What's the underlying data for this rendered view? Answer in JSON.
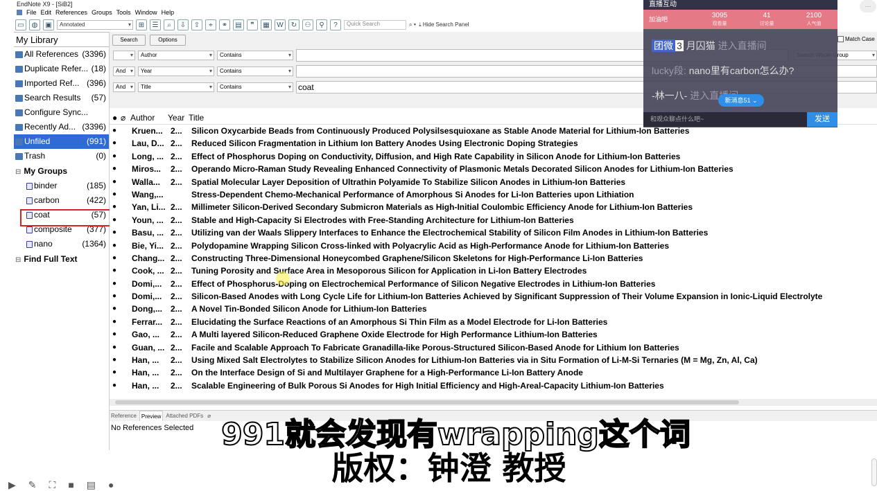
{
  "window": {
    "title": "EndNote X9 - [SiB2]"
  },
  "menu": [
    "File",
    "Edit",
    "References",
    "Groups",
    "Tools",
    "Window",
    "Help"
  ],
  "toolbar": {
    "style": "Annotated",
    "quick_search_placeholder": "Quick Search",
    "hide_search_panel": "Hide Search Panel"
  },
  "sidebar": {
    "library_title": "My Library",
    "items": [
      {
        "label": "All References",
        "count": "(3396)"
      },
      {
        "label": "Duplicate Refer...",
        "count": "(18)"
      },
      {
        "label": "Imported Ref...",
        "count": "(396)"
      },
      {
        "label": "Search Results",
        "count": "(57)"
      },
      {
        "label": "Configure Sync...",
        "count": ""
      },
      {
        "label": "Recently Ad...",
        "count": "(3396)"
      },
      {
        "label": "Unfiled",
        "count": "(991)"
      },
      {
        "label": "Trash",
        "count": "(0)"
      }
    ],
    "groups_heading": "My Groups",
    "groups": [
      {
        "label": "binder",
        "count": "(185)"
      },
      {
        "label": "carbon",
        "count": "(422)"
      },
      {
        "label": "coat",
        "count": "(57)"
      },
      {
        "label": "composite",
        "count": "(377)"
      },
      {
        "label": "nano",
        "count": "(1364)"
      }
    ],
    "find_full_text": "Find Full Text"
  },
  "search_panel": {
    "search_button": "Search",
    "options_button": "Options",
    "scope": "Search Whole Group",
    "match_case": "Match Case",
    "rows": [
      {
        "bool": "",
        "field": "Author",
        "condition": "Contains",
        "value": ""
      },
      {
        "bool": "And",
        "field": "Year",
        "condition": "Contains",
        "value": ""
      },
      {
        "bool": "And",
        "field": "Title",
        "condition": "Contains",
        "value": "coat"
      }
    ]
  },
  "list": {
    "headers": {
      "author": "Author",
      "year": "Year",
      "title": "Title"
    },
    "rows": [
      {
        "author": "Kruen...",
        "year": "2...",
        "title": "Silicon Oxycarbide Beads from Continuously Produced Polysilsesquioxane as Stable Anode Material for Lithium-Ion Batteries"
      },
      {
        "author": "Lau, D...",
        "year": "2...",
        "title": "Reduced Silicon Fragmentation in Lithium Ion Battery Anodes Using Electronic Doping Strategies"
      },
      {
        "author": "Long, ...",
        "year": "2...",
        "title": "Effect of Phosphorus Doping on Conductivity, Diffusion, and High Rate Capability in Silicon Anode for Lithium-Ion Batteries"
      },
      {
        "author": "Miros...",
        "year": "2...",
        "title": "Operando Micro-Raman Study Revealing Enhanced Connectivity of Plasmonic Metals Decorated Silicon Anodes for Lithium-Ion Batteries"
      },
      {
        "author": "Walla...",
        "year": "2...",
        "title": "Spatial Molecular Layer Deposition of Ultrathin Polyamide To Stabilize Silicon Anodes in Lithium-Ion Batteries"
      },
      {
        "author": "Wang,...",
        "year": "",
        "title": "Stress-Dependent Chemo-Mechanical Performance of Amorphous Si Anodes for Li-Ion Batteries upon Lithiation"
      },
      {
        "author": "Yan, Li...",
        "year": "2...",
        "title": "Millimeter Silicon-Derived Secondary Submicron Materials as High-Initial Coulombic Efficiency Anode for Lithium-Ion Batteries"
      },
      {
        "author": "Youn, ...",
        "year": "2...",
        "title": "Stable and High-Capacity Si Electrodes with Free-Standing Architecture for Lithium-Ion Batteries"
      },
      {
        "author": "Basu, ...",
        "year": "2...",
        "title": "Utilizing van der Waals Slippery Interfaces to Enhance the Electrochemical Stability of Silicon Film Anodes in Lithium-Ion Batteries"
      },
      {
        "author": "Bie, Yi...",
        "year": "2...",
        "title": "Polydopamine Wrapping Silicon Cross-linked with Polyacrylic Acid as High-Performance Anode for Lithium-Ion Batteries"
      },
      {
        "author": "Chang...",
        "year": "2...",
        "title": "Constructing Three-Dimensional Honeycombed Graphene/Silicon Skeletons for High-Performance Li-Ion Batteries"
      },
      {
        "author": "Cook, ...",
        "year": "2...",
        "title": "Tuning Porosity and Surface Area in Mesoporous Silicon for Application in Li-Ion Battery Electrodes"
      },
      {
        "author": "Domi,...",
        "year": "2...",
        "title": "Effect of Phosphorus-Doping on Electrochemical Performance of Silicon Negative Electrodes in Lithium-Ion Batteries"
      },
      {
        "author": "Domi,...",
        "year": "2...",
        "title": "Silicon-Based Anodes with Long Cycle Life for Lithium-Ion Batteries Achieved by Significant Suppression of Their Volume Expansion in Ionic-Liquid Electrolyte"
      },
      {
        "author": "Dong,...",
        "year": "2...",
        "title": "A Novel Tin-Bonded Silicon Anode for Lithium-Ion Batteries"
      },
      {
        "author": "Ferrar...",
        "year": "2...",
        "title": "Elucidating the Surface Reactions of an Amorphous Si Thin Film as a Model Electrode for Li-Ion Batteries"
      },
      {
        "author": "Gao, ...",
        "year": "2...",
        "title": "A Multi layered Silicon-Reduced Graphene Oxide Electrode for High Performance Lithium-Ion Batteries"
      },
      {
        "author": "Guan, ...",
        "year": "2...",
        "title": "Facile and Scalable Approach To Fabricate Granadilla-like Porous-Structured Silicon-Based Anode for Lithium Ion Batteries"
      },
      {
        "author": "Han, ...",
        "year": "2...",
        "title": "Using Mixed Salt Electrolytes to Stabilize Silicon Anodes for Lithium-Ion Batteries via in Situ Formation of Li-M-Si Ternaries (M = Mg, Zn, Al, Ca)"
      },
      {
        "author": "Han, ...",
        "year": "2...",
        "title": "On the Interface Design of Si and Multilayer Graphene for a High-Performance Li-Ion Battery Anode"
      },
      {
        "author": "Han, ...",
        "year": "2...",
        "title": "Scalable Engineering of Bulk Porous Si Anodes for High Initial Efficiency and High-Areal-Capacity Lithium-Ion Batteries"
      }
    ]
  },
  "bottom": {
    "tabs": [
      "Reference",
      "Preview",
      "Attached PDFs"
    ],
    "preview_text": "No References Selected"
  },
  "live_overlay": {
    "title": "直播互动",
    "stats": [
      {
        "label": "加油吧",
        "value": ""
      },
      {
        "value": "3095",
        "label": "观看量"
      },
      {
        "value": "41",
        "label": "讨论量"
      },
      {
        "value": "2100",
        "label": "人气值"
      }
    ],
    "comments": [
      {
        "tag": "团微",
        "num": "3",
        "user": "月囚猫",
        "text": "进入直播间"
      },
      {
        "user": "lucky段:",
        "text": "nano里有carbon怎么办?"
      },
      {
        "user": "-林一八-",
        "text": "进入直播间"
      }
    ],
    "new_messages": "新消息51",
    "input_placeholder": "和观众聊点什么吧~",
    "send": "发送"
  },
  "subtitles": {
    "line1": "991就会发现有wrapping这个词",
    "line2": "版权：钟澄 教授"
  }
}
